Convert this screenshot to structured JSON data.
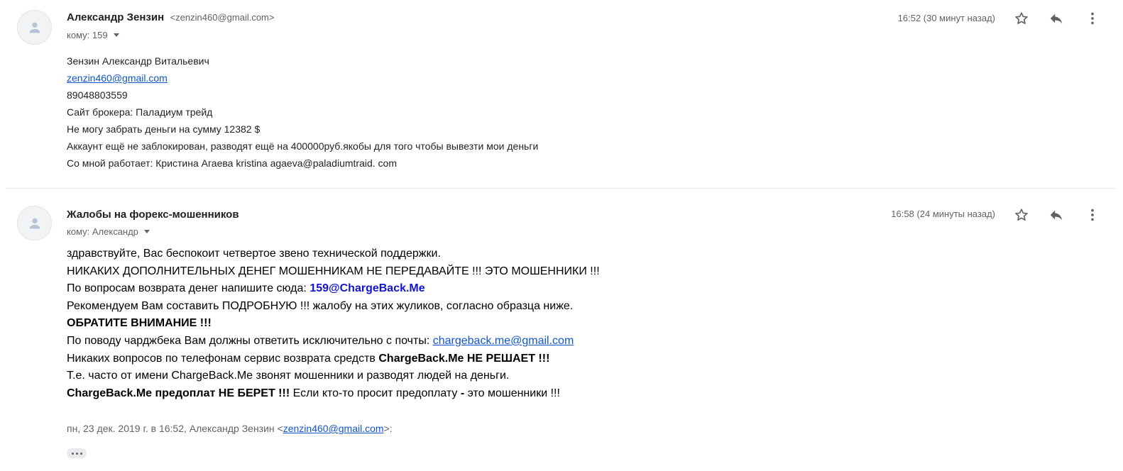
{
  "messages": [
    {
      "sender_name": "Александр Зензин",
      "sender_email": "<zenzin460@gmail.com>",
      "to": "кому: 159",
      "time": "16:52 (30 минут назад)",
      "body_lines": [
        "Зензин Александр Витальевич",
        "zenzin460@gmail.com",
        "89048803559",
        "Сайт брокера: Паладиум трейд",
        "Не могу забрать деньги на сумму 12382 $",
        "Аккаунт ещё не заблокирован, разводят ещё на 400000руб.якобы для того чтобы вывезти мои деньги",
        "Со мной работает: Кристина Агаева kristina agaeva@paladiumtraid. com"
      ]
    },
    {
      "sender_name": "Жалобы на форекс-мошенников",
      "to": "кому: Александр",
      "time": "16:58 (24 минуты назад)",
      "body": {
        "line1": "здравствуйте, Вас беспокоит четвертое звено технической поддержки.",
        "line2": "НИКАКИХ ДОПОЛНИТЕЛЬНЫХ ДЕНЕГ МОШЕННИКАМ НЕ ПЕРЕДАВАЙТЕ !!! ЭТО МОШЕННИКИ !!!",
        "line3_prefix": "По вопросам возврата денег напишите сюда: ",
        "line3_email": "159@ChargeBack.Me",
        "line4": "Рекомендуем Вам составить ПОДРОБНУЮ !!! жалобу на этих жуликов, согласно образца ниже.",
        "line5": "ОБРАТИТЕ ВНИМАНИЕ !!!",
        "line6_prefix": "По поводу чарджбека Вам должны ответить исключительно с почты: ",
        "line6_email": "chargeback.me@gmail.com",
        "line7_prefix": "Никаких вопросов по телефонам сервис возврата средств ",
        "line7_bold": "ChargeBack.Me НЕ РЕШАЕТ !!!",
        "line8": "Т.е. часто от имени ChargeBack.Me звонят мошенники и разводят людей на деньги.",
        "line9_bold": "ChargeBack.Me предоплат НЕ БЕРЕТ !!!",
        "line9_mid": " Если кто-то просит предоплату ",
        "line9_dash": "-",
        "line9_end": " это мошенники !!!"
      },
      "quote_prefix": "пн, 23 дек. 2019 г. в 16:52, Александр Зензин <",
      "quote_email": "zenzin460@gmail.com",
      "quote_suffix": ">:"
    }
  ],
  "icons": [
    "avatar-person-icon",
    "star-icon",
    "reply-icon",
    "more-vert-icon",
    "caret-down-icon",
    "ellipsis-icon"
  ],
  "colors": {
    "link": "#1155cc",
    "highlight_email": "#1313d4",
    "meta": "#5f6368"
  }
}
